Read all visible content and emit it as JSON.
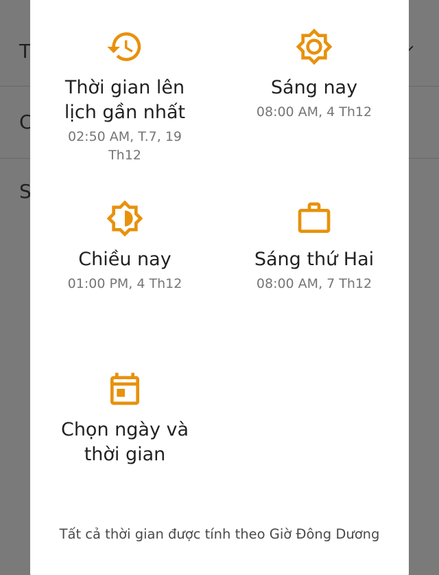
{
  "theme": {
    "accent": "#E8910C",
    "title_color": "#222222",
    "subtitle_color": "#757575"
  },
  "background": {
    "rows": [
      "T",
      "C",
      "S"
    ]
  },
  "options": [
    {
      "icon": "history-icon",
      "title": "Thời gian lên lịch gần nhất",
      "subtitle": "02:50 AM, T.7, 19 Th12"
    },
    {
      "icon": "sun-icon",
      "title": "Sáng nay",
      "subtitle": "08:00 AM, 4 Th12"
    },
    {
      "icon": "half-sun-icon",
      "title": "Chiều nay",
      "subtitle": "01:00 PM, 4 Th12"
    },
    {
      "icon": "briefcase-icon",
      "title": "Sáng thứ Hai",
      "subtitle": "08:00 AM, 7 Th12"
    },
    {
      "icon": "calendar-icon",
      "title": "Chọn ngày và thời gian",
      "subtitle": ""
    }
  ],
  "footer": {
    "timezone_note": "Tất cả thời gian được tính theo Giờ Đông Dương"
  }
}
